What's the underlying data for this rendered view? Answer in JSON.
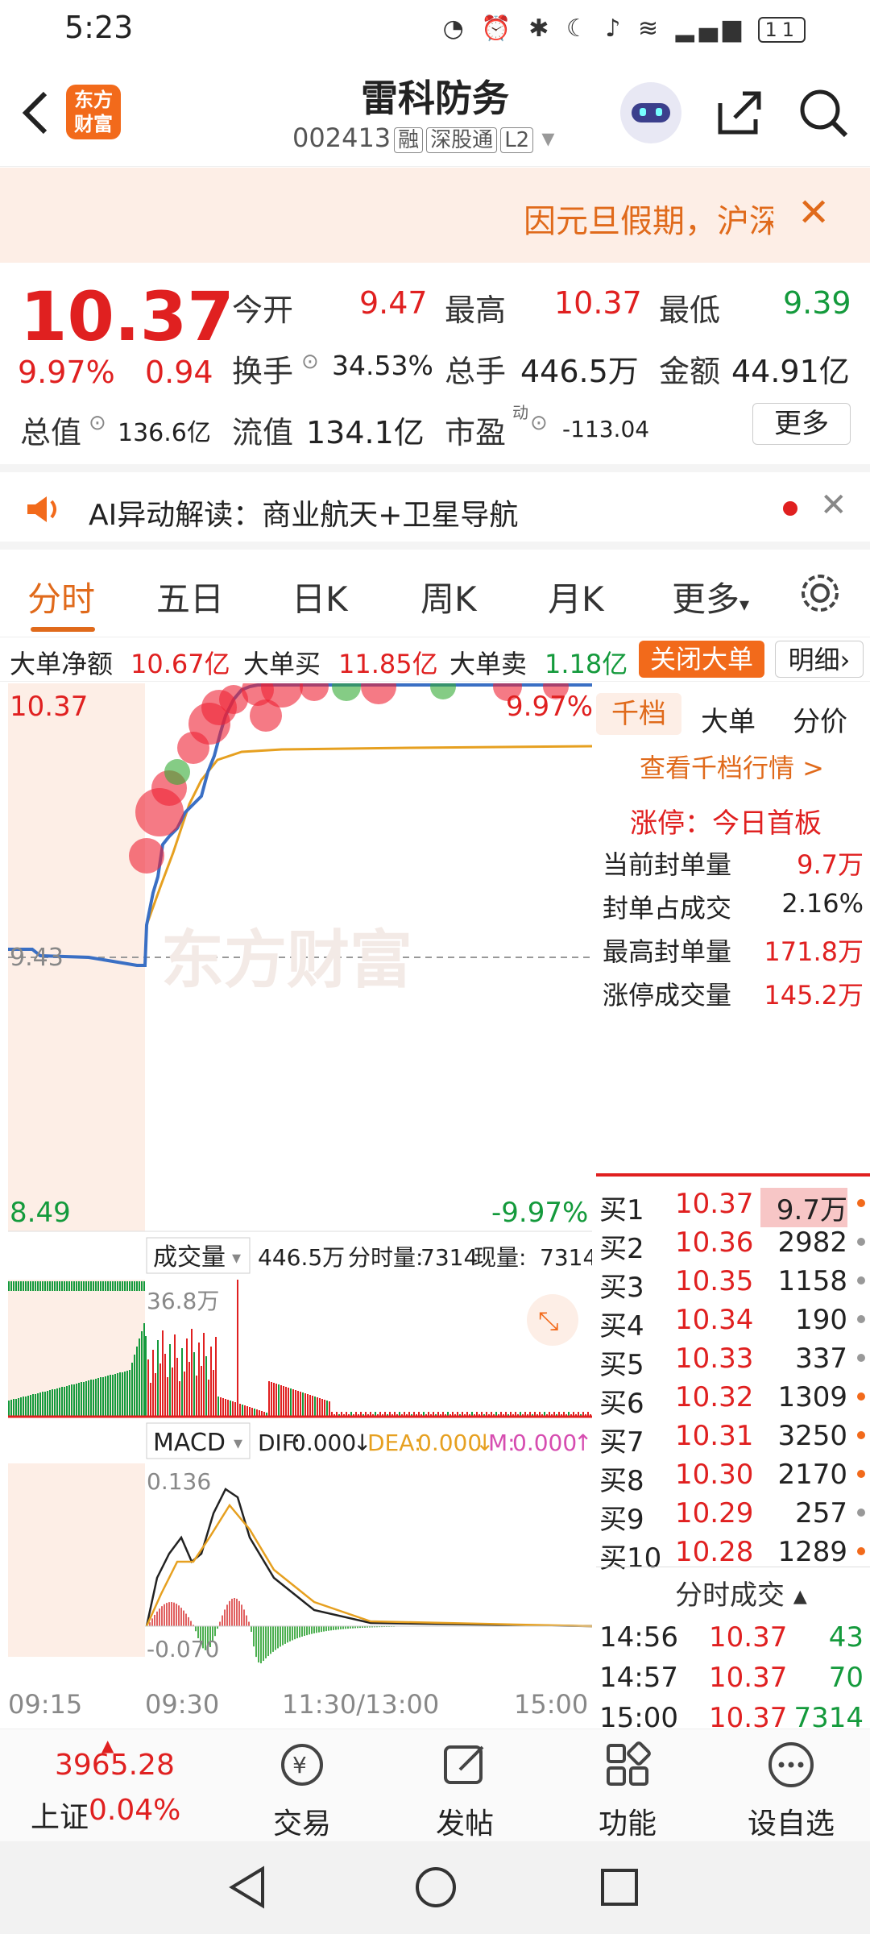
{
  "status": {
    "time": "5:23",
    "battery": "11"
  },
  "header": {
    "title": "雷科防务",
    "code": "002413",
    "tags": [
      "融",
      "深股通",
      "L2"
    ],
    "logo_line1": "东方",
    "logo_line2": "财富"
  },
  "notice": {
    "text": "因元旦假期，沪深"
  },
  "quote": {
    "price": "10.37",
    "pct": "9.97%",
    "chg": "0.94",
    "open_label": "今开",
    "open": "9.47",
    "high_label": "最高",
    "high": "10.37",
    "low_label": "最低",
    "low": "9.39",
    "turnover_label": "换手",
    "turnover": "34.53%",
    "volume_label": "总手",
    "volume": "446.5万",
    "amount_label": "金额",
    "amount": "44.91亿",
    "mktcap_label": "总值",
    "mktcap": "136.6亿",
    "float_label": "流值",
    "float": "134.1亿",
    "pe_label": "市盈",
    "pe_sup": "动",
    "pe": "-113.04",
    "more": "更多"
  },
  "ai": {
    "text": "AI异动解读：商业航天+卫星导航"
  },
  "tabs": [
    "分时",
    "五日",
    "日K",
    "周K",
    "月K",
    "更多"
  ],
  "bigorder": {
    "net_label": "大单净额",
    "net": "10.67亿",
    "buy_label": "大单买",
    "buy": "11.85亿",
    "sell_label": "大单卖",
    "sell": "1.18亿",
    "close": "关闭大单",
    "detail": "明细"
  },
  "chart": {
    "top_price": "10.37",
    "top_pct": "9.97%",
    "mid_price": "9.43",
    "bottom_price": "8.49",
    "bottom_pct": "-9.97%",
    "watermark": "东方财富",
    "vol_label": "成交量",
    "vol_total": "446.5万",
    "vol_fen_label": "分时量:",
    "vol_fen": "7314",
    "vol_now_label": "现量:",
    "vol_now": "7314",
    "vol_max": "36.8万",
    "macd_label": "MACD",
    "dif_label": "DIF:",
    "dif": "0.000",
    "dea_label": "DEA:",
    "dea": "0.000",
    "m_label": "M:",
    "m": "0.000",
    "macd_top": "0.136",
    "macd_bottom": "-0.070",
    "times": [
      "09:15",
      "09:30",
      "11:30/13:00",
      "15:00"
    ]
  },
  "right": {
    "tabs": [
      "千档",
      "大单",
      "分价"
    ],
    "view": "查看千档行情 >",
    "limit_title": "涨停：今日首板",
    "stats": [
      {
        "label": "当前封单量",
        "value": "9.7万"
      },
      {
        "label": "封单占成交",
        "value": "2.16%"
      },
      {
        "label": "最高封单量",
        "value": "171.8万"
      },
      {
        "label": "涨停成交量",
        "value": "145.2万"
      }
    ],
    "orders": [
      {
        "label": "买1",
        "price": "10.37",
        "vol": "9.7万"
      },
      {
        "label": "买2",
        "price": "10.36",
        "vol": "2982"
      },
      {
        "label": "买3",
        "price": "10.35",
        "vol": "1158"
      },
      {
        "label": "买4",
        "price": "10.34",
        "vol": "190"
      },
      {
        "label": "买5",
        "price": "10.33",
        "vol": "337"
      },
      {
        "label": "买6",
        "price": "10.32",
        "vol": "1309"
      },
      {
        "label": "买7",
        "price": "10.31",
        "vol": "3250"
      },
      {
        "label": "买8",
        "price": "10.30",
        "vol": "2170"
      },
      {
        "label": "买9",
        "price": "10.29",
        "vol": "257"
      },
      {
        "label": "买10",
        "price": "10.28",
        "vol": "1289"
      }
    ],
    "trades_title": "分时成交",
    "trades": [
      {
        "time": "14:56",
        "price": "10.37",
        "vol": "43"
      },
      {
        "time": "14:57",
        "price": "10.37",
        "vol": "70"
      },
      {
        "time": "15:00",
        "price": "10.37",
        "vol": "7314"
      }
    ]
  },
  "bottomnav": {
    "index_value": "3965.28",
    "index_name": "上证",
    "index_pct": "0.04%",
    "items": [
      "交易",
      "发帖",
      "功能",
      "设自选"
    ]
  },
  "colors": {
    "up": "#e02020",
    "down": "#149a3c",
    "accent": "#e06a1b"
  }
}
